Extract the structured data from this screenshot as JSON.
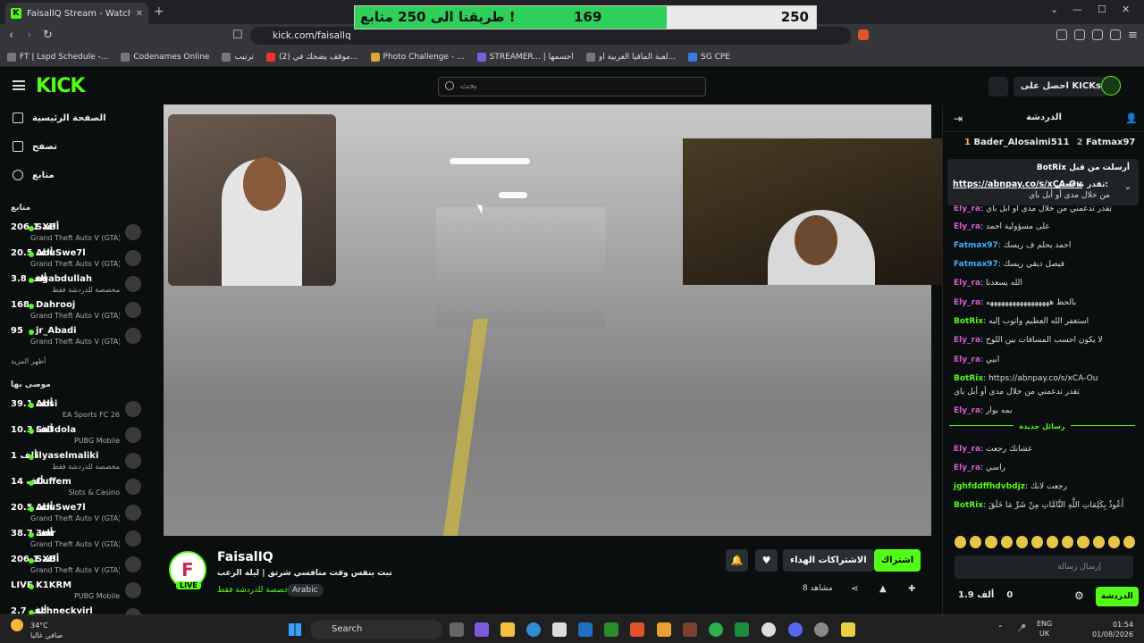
{
  "browser": {
    "tab_title": "FaisalIQ Stream - Watch Live",
    "url": "kick.com/faisallq",
    "bookmarks": [
      "FT | Lspd Schedule -...",
      "Codenames Online",
      "ترتيب",
      "(2) موقف يضحك في...",
      "Photo Challenge - ...",
      "STREAMER... | احسمها",
      "لعبة المافيا العربية او...",
      "SG CPE"
    ]
  },
  "goal": {
    "label": "طريقنا الى 250 متابع !",
    "current": "169",
    "target": "250",
    "progress": 0.676
  },
  "header": {
    "logo": "KICK",
    "search_placeholder": "بحث",
    "get_kicks": "احصل على KICKs"
  },
  "sidebar": {
    "nav": [
      "الصفحة الرئيسية",
      "تصفح",
      "متابع"
    ],
    "following_title": "متابع",
    "following": [
      {
        "name": "SXB",
        "viewers": "206.1 ألف",
        "game": "Grand Theft Auto V (GTA)"
      },
      {
        "name": "AbuSwe7l",
        "viewers": "20.5 ألف",
        "game": "Grand Theft Auto V (GTA)"
      },
      {
        "name": "ogabdullah",
        "viewers": "3.8 ألف",
        "game": "مخصصة للدردشة فقط"
      },
      {
        "name": "Dahrooj",
        "viewers": "168",
        "game": "Grand Theft Auto V (GTA)"
      },
      {
        "name": "jr_Abadi",
        "viewers": "95",
        "game": "Grand Theft Auto V (GTA)"
      }
    ],
    "show_more": "أظهر المزيد",
    "recommended_title": "موصى بها",
    "recommended": [
      {
        "name": "Absi",
        "viewers": "39.1 ألف",
        "game": "EA Sports FC 26"
      },
      {
        "name": "Sa3dola",
        "viewers": "10.3 ألف",
        "game": "PUBG Mobile"
      },
      {
        "name": "ilyaselmaliki",
        "viewers": "1 ألف",
        "game": "مخصصة للدردشة فقط"
      },
      {
        "name": "Cuffem",
        "viewers": "14 ألف",
        "game": "Slots & Casino"
      },
      {
        "name": "AbuSwe7l",
        "viewers": "20.5 ألف",
        "game": "Grand Theft Auto V (GTA)"
      },
      {
        "name": "3mr",
        "viewers": "38.7 ألف",
        "game": "Grand Theft Auto V (GTA)"
      },
      {
        "name": "SXB",
        "viewers": "206.1 ألف",
        "game": "Grand Theft Auto V (GTA)"
      },
      {
        "name": "K1KRM",
        "viewers": "LIVE",
        "game": "PUBG Mobile"
      },
      {
        "name": "schneckvirl",
        "viewers": "2.7 ألف",
        "game": ""
      }
    ]
  },
  "stream": {
    "streamer": "FaisalIQ",
    "live_badge": "LIVE",
    "title": "نبث بنفس وقت منافسي شرتق | ليلة الرعب",
    "category": "مخصصة للدردشة فقط",
    "language": "Arabic",
    "subscribe": "اشتراك",
    "gift_subs": "الاشتراكات الهداء",
    "viewers": "8 مشاهد"
  },
  "chat": {
    "title": "الدردشة",
    "gifters": [
      {
        "name": "Bader_Alosaimi511",
        "rank": "1"
      },
      {
        "name": "Fatmax97",
        "rank": "2"
      }
    ],
    "pinned": {
      "by": "BotRix أرسلت من قبل",
      "link": "https://abnpay.co/s/xCA-Ou",
      "prefix": "تقدر تدعمني:",
      "text": "من خلال مدى أو أبل باي"
    },
    "messages": [
      {
        "user": "Ely_ra",
        "text": "تقدر تدعمني من خلال مدى أو أبل باي",
        "color": "#d45bd0"
      },
      {
        "user": "Ely_ra",
        "text": "على مسؤولية احمد",
        "color": "#d45bd0"
      },
      {
        "user": "Fatmax97",
        "text": "احمد يحلم ف ريسك",
        "color": "#3ab0ff"
      },
      {
        "user": "Fatmax97",
        "text": "فيصل ديقي ريسك",
        "color": "#3ab0ff"
      },
      {
        "user": "Ely_ra",
        "text": "الله يسعدنا",
        "color": "#d45bd0"
      },
      {
        "user": "Ely_ra",
        "text": "بالحظ هههههههههههههههههه",
        "color": "#d45bd0"
      },
      {
        "user": "BotRix",
        "text": "استغفر الله العظيم واتوب إليه",
        "color": "#53fc18"
      },
      {
        "user": "Ely_ra",
        "text": "لا يكون احسب المسافات بين اللوح",
        "color": "#d45bd0"
      },
      {
        "user": "Ely_ra",
        "text": "ابيي",
        "color": "#d45bd0"
      },
      {
        "user": "BotRix",
        "text": "https://abnpay.co/s/xCA-Ou",
        "color": "#53fc18"
      },
      {
        "user": "",
        "text": "تقدر تدعمني من خلال مدى أو أبل باي",
        "color": "#ddd"
      },
      {
        "user": "Ely_ra",
        "text": "بمه بوار",
        "color": "#d45bd0"
      }
    ],
    "new_messages": "رسائل جديدة",
    "messages2": [
      {
        "user": "Ely_ra",
        "text": "عشانك رجعت",
        "color": "#d45bd0"
      },
      {
        "user": "Ely_ra",
        "text": "راسي",
        "color": "#d45bd0"
      },
      {
        "user": "jghfddffhdvbdjz",
        "text": "رجعت لانك",
        "color": "#53fc18"
      },
      {
        "user": "BotRix",
        "text": "أَعُوذُ بِكَلِمَاتِ اللَّهِ التَّامَّاتِ مِنْ شَرِّ مَا خَلَقَ",
        "color": "#53fc18"
      }
    ],
    "input_placeholder": "إرسال رسالة",
    "send": "الدردشة",
    "points": "1.9 ألف",
    "count": "0"
  },
  "taskbar": {
    "temp": "34°C",
    "weather": "صافي غالبا",
    "search": "Search",
    "lang": "ENG",
    "region": "UK",
    "time": "01:54",
    "date": "01/08/2026"
  }
}
